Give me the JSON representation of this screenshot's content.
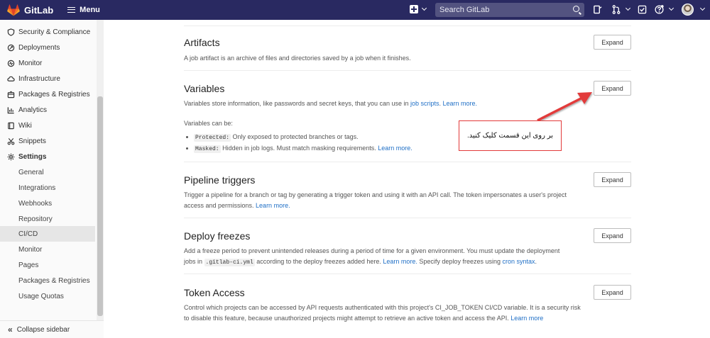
{
  "navbar": {
    "brand": "GitLab",
    "menu_label": "Menu",
    "search_placeholder": "Search GitLab",
    "colors": {
      "bg": "#292961",
      "logo": "#e24329"
    }
  },
  "sidebar": {
    "items": [
      {
        "label": "Security & Compliance",
        "icon": "shield-icon"
      },
      {
        "label": "Deployments",
        "icon": "rocket-icon"
      },
      {
        "label": "Monitor",
        "icon": "monitor-icon"
      },
      {
        "label": "Infrastructure",
        "icon": "cloud-icon"
      },
      {
        "label": "Packages & Registries",
        "icon": "package-icon"
      },
      {
        "label": "Analytics",
        "icon": "chart-icon"
      },
      {
        "label": "Wiki",
        "icon": "book-icon"
      },
      {
        "label": "Snippets",
        "icon": "scissors-icon"
      },
      {
        "label": "Settings",
        "icon": "gear-icon"
      }
    ],
    "subitems": [
      "General",
      "Integrations",
      "Webhooks",
      "Repository",
      "CI/CD",
      "Monitor",
      "Pages",
      "Packages & Registries",
      "Usage Quotas"
    ],
    "active_subitem": "CI/CD",
    "collapse_label": "Collapse sidebar"
  },
  "sections": {
    "artifacts": {
      "title": "Artifacts",
      "desc": "A job artifact is an archive of files and directories saved by a job when it finishes.",
      "button": "Expand"
    },
    "variables": {
      "title": "Variables",
      "desc_pre": "Variables store information, like passwords and secret keys, that you can use in ",
      "desc_link1": "job scripts",
      "desc_mid": ". ",
      "desc_link2": "Learn more.",
      "can_be": "Variables can be:",
      "protected_code": "Protected:",
      "protected_text": " Only exposed to protected branches or tags.",
      "masked_code": "Masked:",
      "masked_text": " Hidden in job logs. Must match masking requirements. ",
      "masked_link": "Learn more.",
      "button": "Expand"
    },
    "triggers": {
      "title": "Pipeline triggers",
      "desc": "Trigger a pipeline for a branch or tag by generating a trigger token and using it with an API call. The token impersonates a user's project",
      "desc2": "access and permissions. ",
      "link": "Learn more.",
      "button": "Expand"
    },
    "freezes": {
      "title": "Deploy freezes",
      "desc": "Add a freeze period to prevent unintended releases during a period of time for a given environment. You must update the deployment",
      "desc2_pre": "jobs in ",
      "code": ".gitlab-ci.yml",
      "desc2_mid": " according to the deploy freezes added here. ",
      "link1": "Learn more.",
      "desc2_post": " Specify deploy freezes using ",
      "link2": "cron syntax",
      "desc2_end": ".",
      "button": "Expand"
    },
    "token": {
      "title": "Token Access",
      "desc": "Control which projects can be accessed by API requests authenticated with this project's CI_JOB_TOKEN CI/CD variable. It is a security risk",
      "desc2": "to disable this feature, because unauthorized projects might attempt to retrieve an active token and access the API. ",
      "link": "Learn more",
      "button": "Expand"
    }
  },
  "annotation": {
    "text": "بر روی این قسمت کلیک کنید.",
    "color": "#e23a3a"
  }
}
